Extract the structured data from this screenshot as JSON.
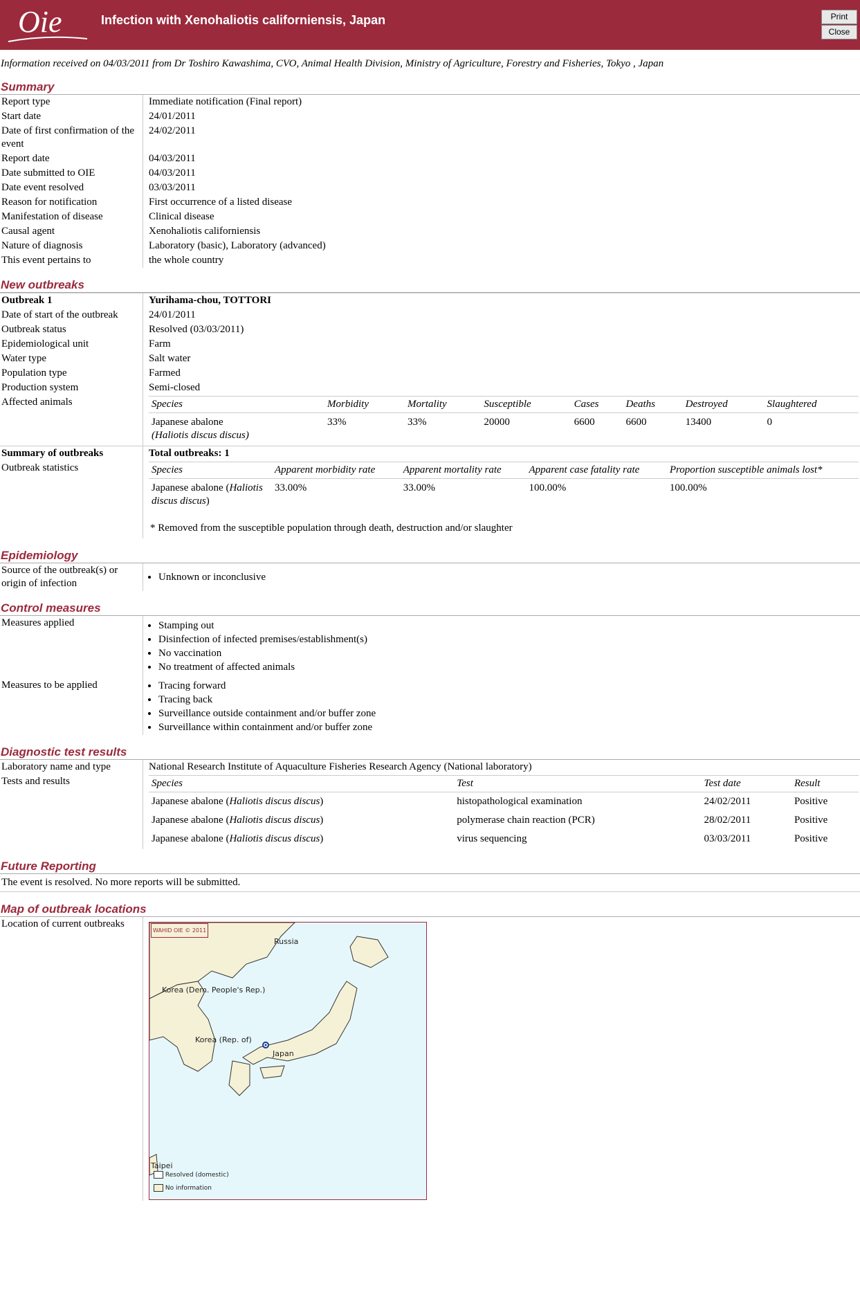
{
  "header": {
    "title": "Infection with Xenohaliotis californiensis, Japan",
    "print_label": "Print",
    "close_label": "Close"
  },
  "info_line": "Information received on 04/03/2011 from Dr Toshiro Kawashima, CVO, Animal Health Division, Ministry of Agriculture, Forestry and Fisheries, Tokyo , Japan",
  "summary": {
    "title": "Summary",
    "rows": [
      {
        "k": "Report type",
        "v": "Immediate notification (Final report)"
      },
      {
        "k": "Start date",
        "v": "24/01/2011"
      },
      {
        "k": "Date of first confirmation of the event",
        "v": "24/02/2011"
      },
      {
        "k": "Report date",
        "v": "04/03/2011"
      },
      {
        "k": "Date submitted to OIE",
        "v": "04/03/2011"
      },
      {
        "k": "Date event resolved",
        "v": "03/03/2011"
      },
      {
        "k": "Reason for notification",
        "v": "First occurrence of a listed disease"
      },
      {
        "k": "Manifestation of disease",
        "v": "Clinical disease"
      },
      {
        "k": "Causal agent",
        "v": "Xenohaliotis californiensis"
      },
      {
        "k": "Nature of diagnosis",
        "v": "Laboratory (basic), Laboratory (advanced)"
      },
      {
        "k": "This event pertains to",
        "v": "the whole country"
      }
    ]
  },
  "outbreaks": {
    "title": "New outbreaks",
    "outbreak_label": "Outbreak 1",
    "outbreak_location": "Yurihama-chou, TOTTORI",
    "rows": [
      {
        "k": "Date of start of the outbreak",
        "v": "24/01/2011"
      },
      {
        "k": "Outbreak status",
        "v": "Resolved (03/03/2011)"
      },
      {
        "k": "Epidemiological unit",
        "v": "Farm"
      },
      {
        "k": "Water type",
        "v": "Salt water"
      },
      {
        "k": "Population type",
        "v": "Farmed"
      },
      {
        "k": "Production system",
        "v": "Semi-closed"
      }
    ],
    "affected_label": "Affected animals",
    "animals_headers": [
      "Species",
      "Morbidity",
      "Mortality",
      "Susceptible",
      "Cases",
      "Deaths",
      "Destroyed",
      "Slaughtered"
    ],
    "animals_row": {
      "species": "Japanese abalone",
      "species_latin": "(Haliotis discus discus)",
      "morbidity": "33%",
      "mortality": "33%",
      "susceptible": "20000",
      "cases": "6600",
      "deaths": "6600",
      "destroyed": "13400",
      "slaughtered": "0"
    },
    "summary_label": "Summary of outbreaks",
    "total_label": "Total outbreaks: 1",
    "stats_label": "Outbreak statistics",
    "stats_headers": [
      "Species",
      "Apparent morbidity rate",
      "Apparent mortality rate",
      "Apparent case fatality rate",
      "Proportion susceptible animals lost*"
    ],
    "stats_row": {
      "species": "Japanese abalone (",
      "species_latin": "Haliotis discus discus",
      "species_end": ")",
      "morbidity": "33.00%",
      "mortality": "33.00%",
      "fatality": "100.00%",
      "lost": "100.00%"
    },
    "footnote": "* Removed from the susceptible population through death, destruction and/or slaughter"
  },
  "epidemiology": {
    "title": "Epidemiology",
    "k": "Source of the outbreak(s) or origin of infection",
    "items": [
      "Unknown or inconclusive"
    ]
  },
  "control": {
    "title": "Control measures",
    "applied_label": "Measures applied",
    "applied": [
      "Stamping out",
      "Disinfection of infected premises/establishment(s)",
      "No vaccination",
      "No treatment of affected animals"
    ],
    "to_apply_label": "Measures to be applied",
    "to_apply": [
      "Tracing forward",
      "Tracing back",
      "Surveillance outside containment and/or buffer zone",
      "Surveillance within containment and/or buffer zone"
    ]
  },
  "diagnostic": {
    "title": "Diagnostic test results",
    "lab_label": "Laboratory name and type",
    "lab": "National Research Institute of Aquaculture Fisheries Research Agency (National laboratory)",
    "tests_label": "Tests and results",
    "headers": [
      "Species",
      "Test",
      "Test date",
      "Result"
    ],
    "rows": [
      {
        "species": "Japanese abalone (",
        "latin": "Haliotis discus discus",
        "end": ")",
        "test": "histopathological examination",
        "date": "24/02/2011",
        "result": "Positive"
      },
      {
        "species": "Japanese abalone (",
        "latin": "Haliotis discus discus",
        "end": ")",
        "test": "polymerase chain reaction (PCR)",
        "date": "28/02/2011",
        "result": "Positive"
      },
      {
        "species": "Japanese abalone (",
        "latin": "Haliotis discus discus",
        "end": ")",
        "test": "virus sequencing",
        "date": "03/03/2011",
        "result": "Positive"
      }
    ]
  },
  "future": {
    "title": "Future Reporting",
    "text": "The event is resolved. No more reports will be submitted."
  },
  "map": {
    "title": "Map of outbreak locations",
    "k": "Location of current outbreaks",
    "watermark": "WAHID OIE © 2011",
    "labels": {
      "russia": "Russia",
      "korea_dpr": "Korea (Dem. People's Rep.)",
      "korea_rep": "Korea (Rep. of)",
      "japan": "Japan",
      "taipei": "Taipei"
    },
    "legend": {
      "resolved": "Resolved (domestic)",
      "noinfo": "No information"
    },
    "colors": {
      "sea": "#e6f7fb",
      "land": "#f5f1d6"
    }
  },
  "colors": {
    "brand": "#9b2a3c"
  }
}
